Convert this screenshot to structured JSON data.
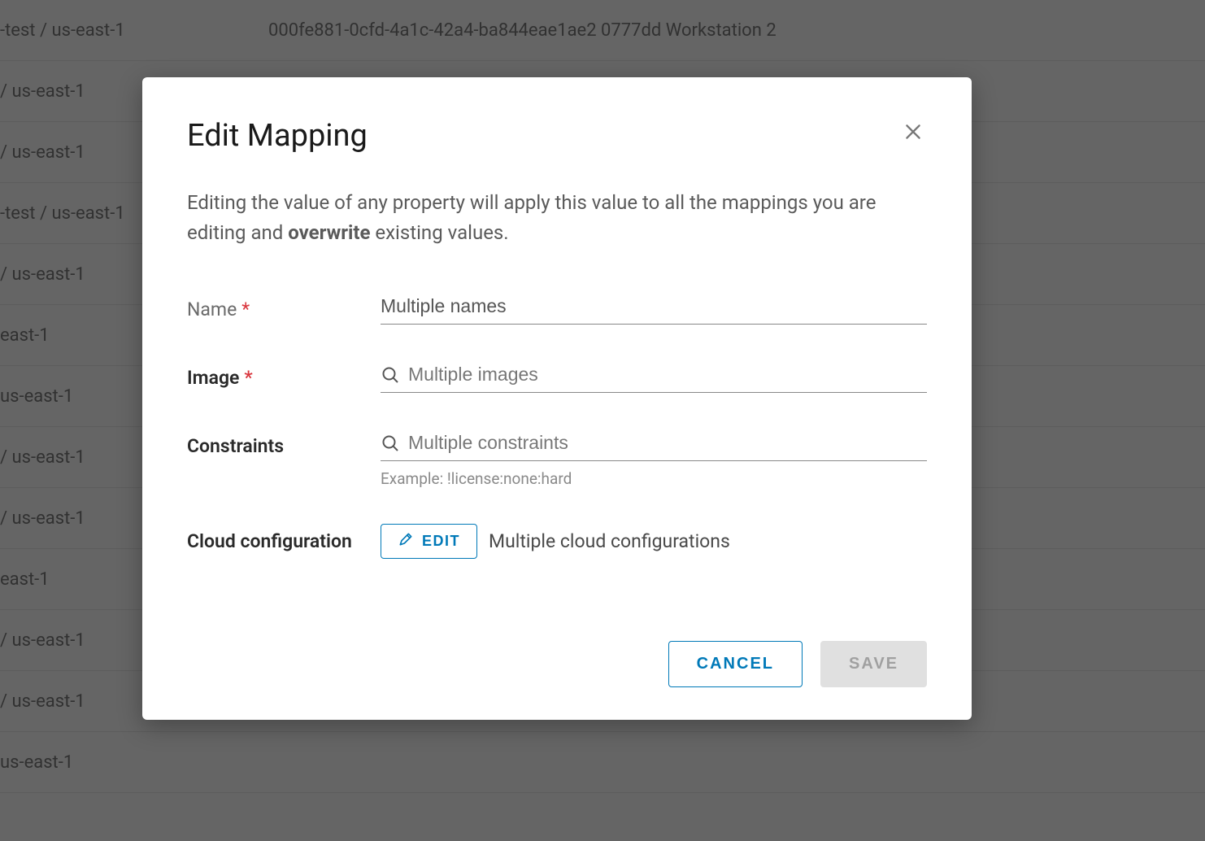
{
  "background": {
    "rows": [
      {
        "c1": "-test / us-east-1",
        "c2": "000fe881-0cfd-4a1c-42a4-ba844eae1ae2 0777dd Workstation 2"
      },
      {
        "c1": "/ us-east-1",
        "c2": ""
      },
      {
        "c1": "/ us-east-1",
        "c2": ""
      },
      {
        "c1": "-test / us-east-1",
        "c2": ""
      },
      {
        "c1": "/ us-east-1",
        "c2": ""
      },
      {
        "c1": "east-1",
        "c2": ""
      },
      {
        "c1": "us-east-1",
        "c2": ""
      },
      {
        "c1": "/ us-east-1",
        "c2": ""
      },
      {
        "c1": "/ us-east-1",
        "c2": ""
      },
      {
        "c1": "east-1",
        "c2": ""
      },
      {
        "c1": "/ us-east-1",
        "c2": ""
      },
      {
        "c1": "/ us-east-1",
        "c2": ""
      },
      {
        "c1": "us-east-1",
        "c2": ""
      }
    ]
  },
  "modal": {
    "title": "Edit Mapping",
    "description_pre": "Editing the value of any property will apply this value to all the mappings you are editing and ",
    "description_strong": "overwrite",
    "description_post": " existing values.",
    "fields": {
      "name": {
        "label": "Name",
        "value": "Multiple names",
        "required": true
      },
      "image": {
        "label": "Image",
        "placeholder": "Multiple images",
        "required": true
      },
      "constraints": {
        "label": "Constraints",
        "placeholder": "Multiple constraints",
        "required": false,
        "hint": "Example: !license:none:hard"
      },
      "cloud": {
        "label": "Cloud configuration",
        "edit_label": "EDIT",
        "value": "Multiple cloud configurations"
      }
    },
    "buttons": {
      "cancel": "CANCEL",
      "save": "SAVE"
    }
  }
}
